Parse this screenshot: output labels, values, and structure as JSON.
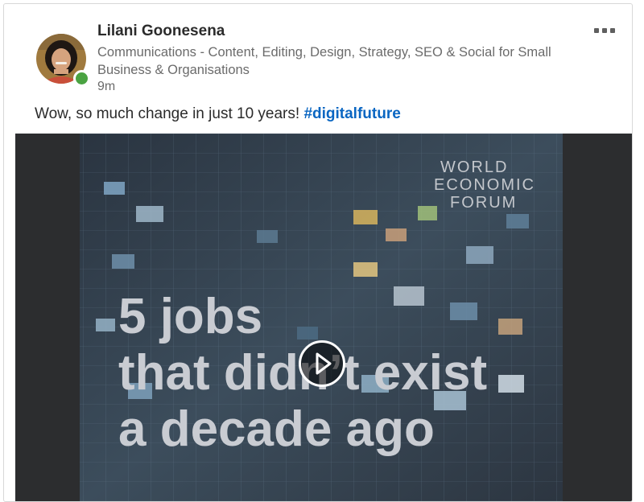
{
  "post": {
    "author_name": "Lilani Goonesena",
    "author_headline": "Communications - Content, Editing, Design, Strategy, SEO & Social for Small Business & Organisations",
    "timestamp": "9m",
    "text_before_hashtag": "Wow, so much change in just 10 years! ",
    "hashtag": "#digitalfuture",
    "avatar_icon": "person-avatar-photo",
    "presence_status": "online",
    "presence_color": "#4aa342",
    "more_icon": "ellipsis-icon"
  },
  "video": {
    "brand_line1": "WORLD",
    "brand_line2": "ECONOMIC",
    "brand_line3": "FORUM",
    "headline_line1": "5 jobs",
    "headline_line2": "that didn’t exist",
    "headline_line3": "a decade ago",
    "play_icon": "play-icon"
  },
  "colors": {
    "accent_link": "#0a66c2",
    "video_background": "#2c2d2f"
  }
}
